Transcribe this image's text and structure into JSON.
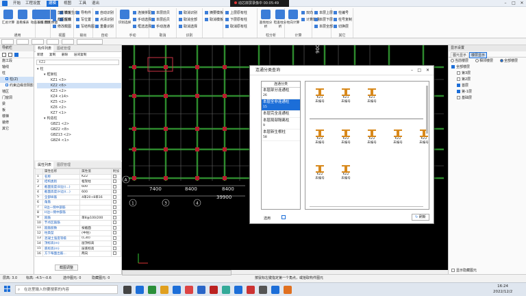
{
  "titlebar": {
    "menu_tabs": [
      "开始",
      "工程设置",
      "建模",
      "视图",
      "工具",
      "退出"
    ],
    "active_tab_index": 2,
    "recorder_text": "动芯拼屏录像中",
    "recorder_time": "00:05:49"
  },
  "ribbon": {
    "groups": [
      {
        "label": "通用",
        "big": [
          "汇总计算",
          "查看报表",
          "动画三维",
          "锁剩余量"
        ],
        "small": [
          "锁定",
          "解锁"
        ]
      },
      {
        "label": "",
        "big": [
          "加工建筑"
        ],
        "small": []
      },
      {
        "label": "视图",
        "big": [],
        "small": [
          "剪影模板生成",
          "截图生成",
          "修改截图"
        ]
      },
      {
        "label": "输出",
        "big": [],
        "small": [
          "导构件",
          "写位置",
          "写结构图"
        ]
      },
      {
        "label": "自动",
        "big": [],
        "small": [
          "自动识别",
          "点清识别",
          "重叠识别"
        ]
      },
      {
        "label": "手动",
        "big": [
          "识别选择"
        ],
        "small": [
          "连接拼配",
          "手动选择",
          "框选选择"
        ]
      },
      {
        "label": "取消",
        "big": [],
        "small": [
          "本层前贝",
          "本层后贝",
          "手动连通"
        ]
      },
      {
        "label": "识别",
        "big": [],
        "small": [
          "取消识别",
          "取消全部",
          "取消选择"
        ]
      },
      {
        "label": "",
        "big": [],
        "small": [
          "摘要模板",
          "取消模板",
          ""
        ]
      },
      {
        "label": "",
        "big": [],
        "small": [
          "上层原有柱",
          "下层原有柱",
          "取消原有柱"
        ]
      },
      {
        "label": "柱分析",
        "big": [
          "查找柱分析",
          "检查柱分析"
        ],
        "small": []
      },
      {
        "label": "计算",
        "big": [
          "柱向计算"
        ],
        "small": [
          "双向",
          "计算数量"
        ]
      },
      {
        "label": "",
        "big": [],
        "small": [
          "本层上层",
          "本层下层",
          "本层全部"
        ]
      },
      {
        "label": "其它",
        "big": [],
        "small": [
          "柱编号",
          "柱号复制",
          "切换层"
        ]
      }
    ]
  },
  "left_nav": {
    "header": "导航栏",
    "items": [
      "施工段",
      "轴线",
      "柱",
      "柱(Z)",
      "约束边缘非阴影区",
      "墙",
      "门窗洞",
      "梁",
      "板",
      "楼梯",
      "装修",
      "其它"
    ],
    "selected": "柱(Z)"
  },
  "component_list": {
    "tabs": [
      "构件列表",
      "图纸管理"
    ],
    "toolbar": [
      "新建",
      "复制",
      "删除",
      "层间复制"
    ],
    "search_placeholder": "KZ2",
    "tree": [
      {
        "label": "柱",
        "level": 0
      },
      {
        "label": "框架柱",
        "level": 1
      },
      {
        "label": "KZ1 <3>",
        "level": 2
      },
      {
        "label": "KZ2 <6>",
        "level": 2,
        "selected": true
      },
      {
        "label": "KZ3 <2>",
        "level": 2
      },
      {
        "label": "KZ4 <14>",
        "level": 2
      },
      {
        "label": "KZ5 <2>",
        "level": 2
      },
      {
        "label": "KZ6 <2>",
        "level": 2
      },
      {
        "label": "KZ7 <1>",
        "level": 2
      },
      {
        "label": "构造柱",
        "level": 1
      },
      {
        "label": "GBZ1 <2>",
        "level": 2
      },
      {
        "label": "GBZ2 <8>",
        "level": 2
      },
      {
        "label": "GBZ13 <2>",
        "level": 2
      },
      {
        "label": "GBZ4 <1>",
        "level": 2
      }
    ]
  },
  "properties": {
    "tabs": [
      "属性列表",
      "图层管理"
    ],
    "headers": [
      "属性名称",
      "属性值",
      "附加"
    ],
    "rows": [
      {
        "num": "1",
        "name": "名称",
        "value": "KZ2"
      },
      {
        "num": "2",
        "name": "结构类别",
        "value": "框架柱"
      },
      {
        "num": "3",
        "name": "截面宽度(B边)(...)",
        "value": "600"
      },
      {
        "num": "4",
        "name": "截面高度(H边)(...)",
        "value": "600"
      },
      {
        "num": "5",
        "name": "全部纵筋",
        "value": "4单20+8单16"
      },
      {
        "num": "6",
        "name": "角筋",
        "value": ""
      },
      {
        "num": "7",
        "name": "B边一侧中部筋",
        "value": ""
      },
      {
        "num": "8",
        "name": "H边一侧中部筋",
        "value": ""
      },
      {
        "num": "9",
        "name": "箍筋",
        "value": "单8@100/200"
      },
      {
        "num": "10",
        "name": "节点区箍筋",
        "value": ""
      },
      {
        "num": "11",
        "name": "箍筋肢数",
        "value": "按截面"
      },
      {
        "num": "12",
        "name": "柱类型",
        "value": "(中柱)"
      },
      {
        "num": "13",
        "name": "混凝土强度等级",
        "value": "(C30)"
      },
      {
        "num": "14",
        "name": "顶标高(m)",
        "value": "层顶标高"
      },
      {
        "num": "15",
        "name": "底标高(m)",
        "value": "层底标高"
      },
      {
        "num": "16",
        "name": "方下每面出筋...",
        "value": "两向"
      }
    ],
    "footer_button": "截图调整"
  },
  "canvas": {
    "dimensions_bottom": [
      "7400",
      "8400",
      "8400"
    ],
    "total_dimension": "39900",
    "axis_labels_bottom": [
      "1",
      "3",
      "4"
    ],
    "axis_labels_left": [
      "A"
    ],
    "vertical_dimension": "9000"
  },
  "dialog": {
    "title": "连通分类查询",
    "list_header": "连通分类",
    "categories": [
      {
        "label": "本层部分连通柱",
        "count": "26",
        "selected": false
      },
      {
        "label": "本层全非连通柱",
        "count": "15",
        "selected": true
      },
      {
        "label": "本层完全连通柱",
        "count": "",
        "selected": false
      },
      {
        "label": "本层局部隔离柱",
        "count": "9",
        "selected": false
      },
      {
        "label": "本层新生根柱",
        "count": "58",
        "selected": false
      }
    ],
    "columns_row1": [
      {
        "name": "KZ1",
        "status": "未编号"
      },
      {
        "name": "KZ1",
        "status": "未编号"
      },
      {
        "name": "KZ1",
        "status": "未编号"
      }
    ],
    "columns_row2": [
      {
        "name": "KZ2",
        "status": "未编号"
      },
      {
        "name": "KZ2",
        "status": "未编号"
      },
      {
        "name": "KZ2",
        "status": "未编号"
      },
      {
        "name": "KZ2",
        "status": "未编号"
      },
      {
        "name": "KZ2",
        "status": "未编号"
      }
    ],
    "columns_row3": [
      {
        "name": "KZ2",
        "status": "未编号"
      },
      {
        "name": "KZ2",
        "status": "未编号"
      }
    ],
    "footer_left": "选用",
    "refresh_button": "刷新",
    "colors": {
      "selected": "#1c6ed8",
      "icon": "#d8891c"
    }
  },
  "right_panel": {
    "header": "显示设置",
    "tabs": [
      "图元显示",
      "楼层显示"
    ],
    "radio": [
      "当前楼层",
      "相邻楼层",
      "全部楼层"
    ],
    "radio_selected": 2,
    "tree": [
      {
        "label": "全部楼层",
        "checked": true,
        "level": 0
      },
      {
        "label": "第3层",
        "checked": false,
        "level": 1
      },
      {
        "label": "第2层",
        "checked": false,
        "level": 1
      },
      {
        "label": "首层",
        "checked": true,
        "level": 1
      },
      {
        "label": "第-1层",
        "checked": true,
        "level": 1
      },
      {
        "label": "基础层",
        "checked": false,
        "level": 1
      }
    ],
    "footer_checkbox": "显示隐藏图元"
  },
  "statusbar": {
    "floor": "层高: 3.0",
    "elevation": "标高: -4.5~-0.6",
    "selected": "选中图元: 0",
    "hidden": "隐藏图元: 0",
    "hint": "按鼠标左键指定第一个角点，或拾取构件图元"
  },
  "taskbar": {
    "search_placeholder": "在这里输入你要搜索的内容",
    "time": "16:24",
    "date": "2022/12/2"
  }
}
